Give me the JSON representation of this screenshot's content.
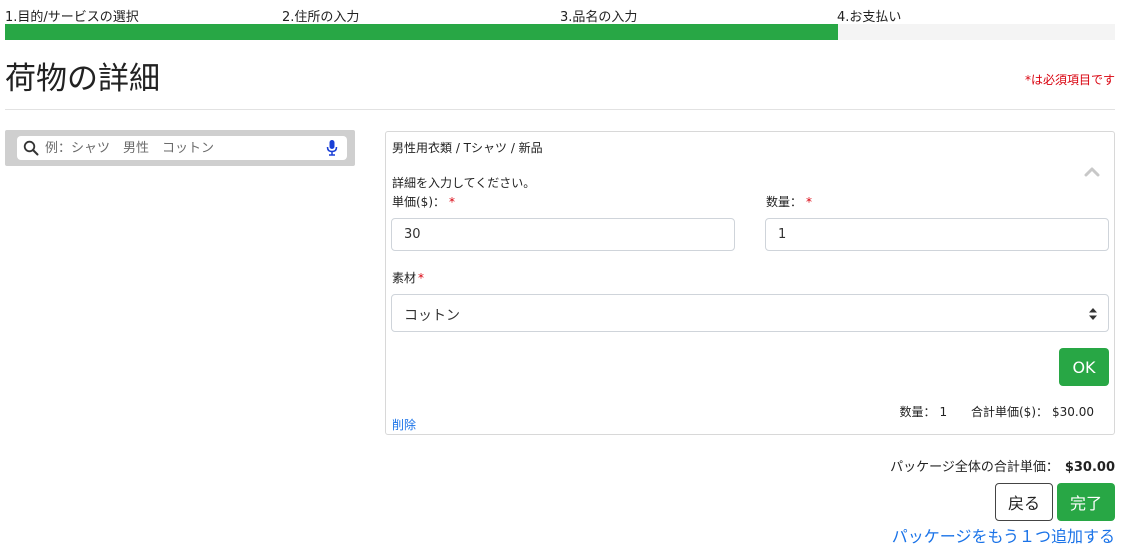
{
  "steps": [
    {
      "label": "1.目的/サービスの選択"
    },
    {
      "label": "2.住所の入力"
    },
    {
      "label": "3.品名の入力"
    },
    {
      "label": "4.お支払い"
    }
  ],
  "progress_percent": 75,
  "colors": {
    "accent": "#28a745",
    "link": "#1a73e8",
    "required": "#d9000d"
  },
  "page": {
    "title": "荷物の詳細",
    "required_note": "*は必須項目です"
  },
  "search": {
    "placeholder": "例：シャツ　男性　コットン",
    "value": "",
    "icon": "search-icon",
    "mic_icon": "microphone-icon"
  },
  "item": {
    "path": "男性用衣類 / Tシャツ / 新品",
    "instructions": "詳細を入力してください。",
    "unit_price_label": "単価($)：",
    "unit_price_value": "30",
    "quantity_label": "数量：",
    "quantity_value": "1",
    "required_mark": "*",
    "material_label": "素材",
    "material_value": "コットン",
    "ok_label": "OK",
    "summary_quantity_label": "数量：",
    "summary_quantity_value": "1",
    "summary_total_label": "合計単価($)：",
    "summary_total_value": "$30.00",
    "delete_label": "削除"
  },
  "footer": {
    "package_total_label": "パッケージ全体の合計単価：",
    "package_total_value": "$30.00",
    "back_label": "戻る",
    "done_label": "完了",
    "add_package_label": "パッケージをもう１つ追加する"
  }
}
